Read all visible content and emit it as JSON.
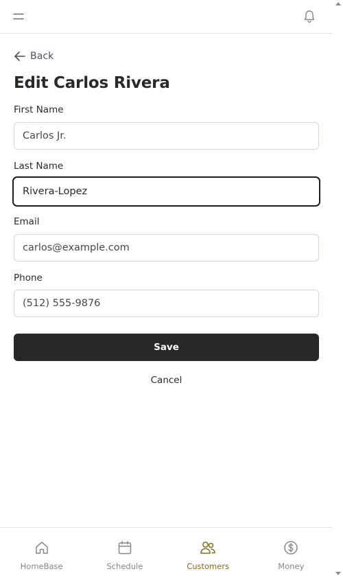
{
  "header": {
    "menu_icon": "menu-icon",
    "notification_icon": "bell-icon"
  },
  "back": {
    "icon": "arrow-left-icon",
    "label": "Back"
  },
  "page": {
    "title": "Edit Carlos Rivera"
  },
  "form": {
    "first_name": {
      "label": "First Name",
      "value": "Carlos Jr."
    },
    "last_name": {
      "label": "Last Name",
      "value": "Rivera-Lopez",
      "focused": true
    },
    "email": {
      "label": "Email",
      "value": "carlos@example.com"
    },
    "phone": {
      "label": "Phone",
      "value": "(512) 555-9876"
    },
    "save_label": "Save",
    "cancel_label": "Cancel"
  },
  "bottom_nav": {
    "active": "Customers",
    "items": [
      {
        "label": "HomeBase",
        "icon": "home-icon"
      },
      {
        "label": "Schedule",
        "icon": "calendar-icon"
      },
      {
        "label": "Customers",
        "icon": "users-icon"
      },
      {
        "label": "Money",
        "icon": "dollar-circle-icon"
      }
    ]
  },
  "colors": {
    "primary_button": "#2a2826",
    "active_nav": "#8a6a14",
    "inactive_nav": "#8a8681",
    "back_link": "#4a4f63",
    "border": "#d9d6d1"
  }
}
